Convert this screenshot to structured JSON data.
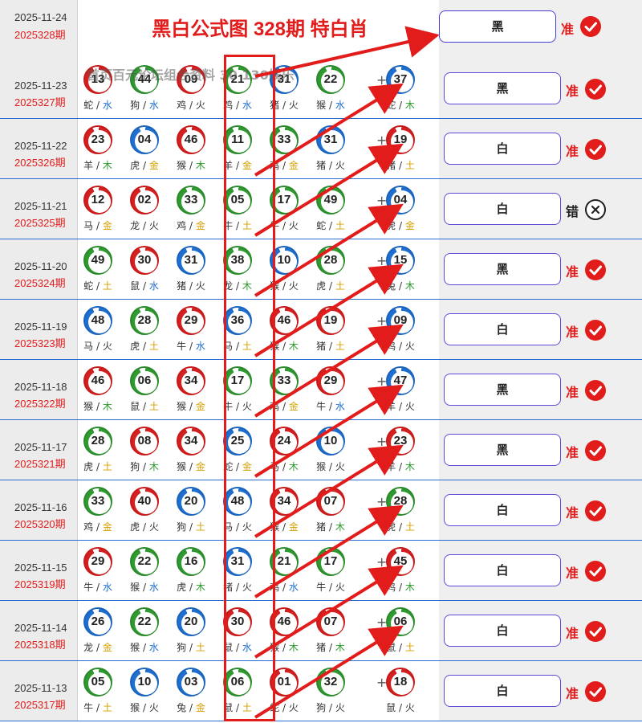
{
  "header": {
    "date": "2025-11-24",
    "period": "2025328期",
    "title": "黑白公式图 328期 特白肖",
    "result_label": "黑",
    "verdict": "准"
  },
  "watermark": "首页百元论坛组合资料 30 130娱乐",
  "colors": {
    "accent_red": "#e21b1b",
    "border_blue": "#2b6bd6",
    "button_border": "#5b4ad8"
  },
  "plus_sign": "+",
  "rows": [
    {
      "date": "2025-11-23",
      "period": "2025327期",
      "result": "黑",
      "verdict": "准",
      "verdict_icon": "check-icon",
      "balls": [
        {
          "num": "13",
          "color": "red",
          "zodiac": "蛇",
          "element": "水"
        },
        {
          "num": "44",
          "color": "green",
          "zodiac": "狗",
          "element": "水"
        },
        {
          "num": "09",
          "color": "red",
          "zodiac": "鸡",
          "element": "火"
        },
        {
          "num": "21",
          "color": "green",
          "zodiac": "鸡",
          "element": "水"
        },
        {
          "num": "31",
          "color": "blue",
          "zodiac": "猪",
          "element": "火"
        },
        {
          "num": "22",
          "color": "green",
          "zodiac": "猴",
          "element": "水"
        },
        {
          "num": "37",
          "color": "blue",
          "zodiac": "蛇",
          "element": "木"
        }
      ]
    },
    {
      "date": "2025-11-22",
      "period": "2025326期",
      "result": "白",
      "verdict": "准",
      "verdict_icon": "check-icon",
      "balls": [
        {
          "num": "23",
          "color": "red",
          "zodiac": "羊",
          "element": "木"
        },
        {
          "num": "04",
          "color": "blue",
          "zodiac": "虎",
          "element": "金"
        },
        {
          "num": "46",
          "color": "red",
          "zodiac": "猴",
          "element": "木"
        },
        {
          "num": "11",
          "color": "green",
          "zodiac": "羊",
          "element": "金"
        },
        {
          "num": "33",
          "color": "green",
          "zodiac": "鸡",
          "element": "金"
        },
        {
          "num": "31",
          "color": "blue",
          "zodiac": "猪",
          "element": "火"
        },
        {
          "num": "19",
          "color": "red",
          "zodiac": "猪",
          "element": "土"
        }
      ]
    },
    {
      "date": "2025-11-21",
      "period": "2025325期",
      "result": "白",
      "verdict": "错",
      "verdict_icon": "x-circle-icon",
      "balls": [
        {
          "num": "12",
          "color": "red",
          "zodiac": "马",
          "element": "金"
        },
        {
          "num": "02",
          "color": "red",
          "zodiac": "龙",
          "element": "火"
        },
        {
          "num": "33",
          "color": "green",
          "zodiac": "鸡",
          "element": "金"
        },
        {
          "num": "05",
          "color": "green",
          "zodiac": "牛",
          "element": "土"
        },
        {
          "num": "17",
          "color": "green",
          "zodiac": "牛",
          "element": "火"
        },
        {
          "num": "49",
          "color": "green",
          "zodiac": "蛇",
          "element": "土"
        },
        {
          "num": "04",
          "color": "blue",
          "zodiac": "虎",
          "element": "金"
        }
      ]
    },
    {
      "date": "2025-11-20",
      "period": "2025324期",
      "result": "黑",
      "verdict": "准",
      "verdict_icon": "check-icon",
      "balls": [
        {
          "num": "49",
          "color": "green",
          "zodiac": "蛇",
          "element": "土"
        },
        {
          "num": "30",
          "color": "red",
          "zodiac": "鼠",
          "element": "水"
        },
        {
          "num": "31",
          "color": "blue",
          "zodiac": "猪",
          "element": "火"
        },
        {
          "num": "38",
          "color": "green",
          "zodiac": "龙",
          "element": "木"
        },
        {
          "num": "10",
          "color": "blue",
          "zodiac": "猴",
          "element": "火"
        },
        {
          "num": "28",
          "color": "green",
          "zodiac": "虎",
          "element": "土"
        },
        {
          "num": "15",
          "color": "blue",
          "zodiac": "兔",
          "element": "木"
        }
      ]
    },
    {
      "date": "2025-11-19",
      "period": "2025323期",
      "result": "白",
      "verdict": "准",
      "verdict_icon": "check-icon",
      "balls": [
        {
          "num": "48",
          "color": "blue",
          "zodiac": "马",
          "element": "火"
        },
        {
          "num": "28",
          "color": "green",
          "zodiac": "虎",
          "element": "土"
        },
        {
          "num": "29",
          "color": "red",
          "zodiac": "牛",
          "element": "水"
        },
        {
          "num": "36",
          "color": "blue",
          "zodiac": "马",
          "element": "土"
        },
        {
          "num": "46",
          "color": "red",
          "zodiac": "猴",
          "element": "木"
        },
        {
          "num": "19",
          "color": "red",
          "zodiac": "猪",
          "element": "土"
        },
        {
          "num": "09",
          "color": "blue",
          "zodiac": "鸡",
          "element": "火"
        }
      ]
    },
    {
      "date": "2025-11-18",
      "period": "2025322期",
      "result": "黑",
      "verdict": "准",
      "verdict_icon": "check-icon",
      "balls": [
        {
          "num": "46",
          "color": "red",
          "zodiac": "猴",
          "element": "木"
        },
        {
          "num": "06",
          "color": "green",
          "zodiac": "鼠",
          "element": "土"
        },
        {
          "num": "34",
          "color": "red",
          "zodiac": "猴",
          "element": "金"
        },
        {
          "num": "17",
          "color": "green",
          "zodiac": "牛",
          "element": "火"
        },
        {
          "num": "33",
          "color": "green",
          "zodiac": "鸡",
          "element": "金"
        },
        {
          "num": "29",
          "color": "red",
          "zodiac": "牛",
          "element": "水"
        },
        {
          "num": "47",
          "color": "blue",
          "zodiac": "羊",
          "element": "火"
        }
      ]
    },
    {
      "date": "2025-11-17",
      "period": "2025321期",
      "result": "黑",
      "verdict": "准",
      "verdict_icon": "check-icon",
      "balls": [
        {
          "num": "28",
          "color": "green",
          "zodiac": "虎",
          "element": "土"
        },
        {
          "num": "08",
          "color": "red",
          "zodiac": "狗",
          "element": "木"
        },
        {
          "num": "34",
          "color": "red",
          "zodiac": "猴",
          "element": "金"
        },
        {
          "num": "25",
          "color": "blue",
          "zodiac": "蛇",
          "element": "金"
        },
        {
          "num": "24",
          "color": "red",
          "zodiac": "马",
          "element": "木"
        },
        {
          "num": "10",
          "color": "blue",
          "zodiac": "猴",
          "element": "火"
        },
        {
          "num": "23",
          "color": "red",
          "zodiac": "羊",
          "element": "木"
        }
      ]
    },
    {
      "date": "2025-11-16",
      "period": "2025320期",
      "result": "白",
      "verdict": "准",
      "verdict_icon": "check-icon",
      "balls": [
        {
          "num": "33",
          "color": "green",
          "zodiac": "鸡",
          "element": "金"
        },
        {
          "num": "40",
          "color": "red",
          "zodiac": "虎",
          "element": "火"
        },
        {
          "num": "20",
          "color": "blue",
          "zodiac": "狗",
          "element": "土"
        },
        {
          "num": "48",
          "color": "blue",
          "zodiac": "马",
          "element": "火"
        },
        {
          "num": "34",
          "color": "red",
          "zodiac": "猴",
          "element": "金"
        },
        {
          "num": "07",
          "color": "red",
          "zodiac": "猪",
          "element": "木"
        },
        {
          "num": "28",
          "color": "green",
          "zodiac": "虎",
          "element": "土"
        }
      ]
    },
    {
      "date": "2025-11-15",
      "period": "2025319期",
      "result": "白",
      "verdict": "准",
      "verdict_icon": "check-icon",
      "balls": [
        {
          "num": "29",
          "color": "red",
          "zodiac": "牛",
          "element": "水"
        },
        {
          "num": "22",
          "color": "green",
          "zodiac": "猴",
          "element": "水"
        },
        {
          "num": "16",
          "color": "green",
          "zodiac": "虎",
          "element": "木"
        },
        {
          "num": "31",
          "color": "blue",
          "zodiac": "猪",
          "element": "火"
        },
        {
          "num": "21",
          "color": "green",
          "zodiac": "鸡",
          "element": "水"
        },
        {
          "num": "17",
          "color": "green",
          "zodiac": "牛",
          "element": "火"
        },
        {
          "num": "45",
          "color": "red",
          "zodiac": "鸡",
          "element": "木"
        }
      ]
    },
    {
      "date": "2025-11-14",
      "period": "2025318期",
      "result": "白",
      "verdict": "准",
      "verdict_icon": "check-icon",
      "balls": [
        {
          "num": "26",
          "color": "blue",
          "zodiac": "龙",
          "element": "金"
        },
        {
          "num": "22",
          "color": "green",
          "zodiac": "猴",
          "element": "水"
        },
        {
          "num": "20",
          "color": "blue",
          "zodiac": "狗",
          "element": "土"
        },
        {
          "num": "30",
          "color": "red",
          "zodiac": "鼠",
          "element": "水"
        },
        {
          "num": "46",
          "color": "red",
          "zodiac": "猴",
          "element": "木"
        },
        {
          "num": "07",
          "color": "red",
          "zodiac": "猪",
          "element": "木"
        },
        {
          "num": "06",
          "color": "green",
          "zodiac": "鼠",
          "element": "土"
        }
      ]
    },
    {
      "date": "2025-11-13",
      "period": "2025317期",
      "result": "白",
      "verdict": "准",
      "verdict_icon": "check-icon",
      "balls": [
        {
          "num": "05",
          "color": "green",
          "zodiac": "牛",
          "element": "土"
        },
        {
          "num": "10",
          "color": "blue",
          "zodiac": "猴",
          "element": "火"
        },
        {
          "num": "03",
          "color": "blue",
          "zodiac": "兔",
          "element": "金"
        },
        {
          "num": "06",
          "color": "green",
          "zodiac": "鼠",
          "element": "土"
        },
        {
          "num": "01",
          "color": "red",
          "zodiac": "蛇",
          "element": "火"
        },
        {
          "num": "32",
          "color": "green",
          "zodiac": "狗",
          "element": "火"
        },
        {
          "num": "18",
          "color": "red",
          "zodiac": "鼠",
          "element": "火"
        }
      ]
    }
  ]
}
